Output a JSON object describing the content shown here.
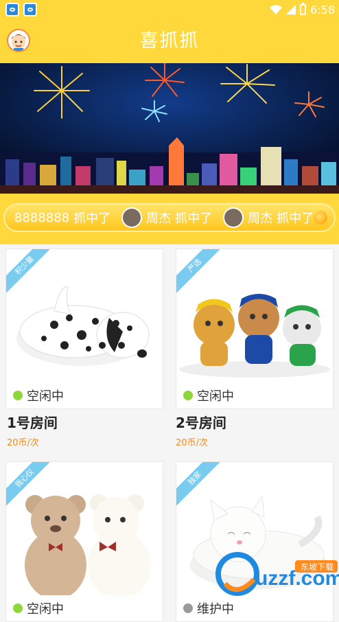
{
  "status_bar": {
    "time": "6:58",
    "notification_icons": [
      "app-notification-icon",
      "app-notification-icon"
    ],
    "system_icons": [
      "wifi-icon",
      "signal-icon",
      "battery-charging-icon"
    ]
  },
  "app_bar": {
    "title": "喜抓抓",
    "avatar_icon": "user-avatar"
  },
  "banner": {
    "image": "fireworks-city-night"
  },
  "ticker": {
    "items": [
      {
        "user": "8888888",
        "action": "抓中了"
      },
      {
        "user": "周杰",
        "action": "抓中了"
      },
      {
        "user": "周杰",
        "action": "抓中了"
      }
    ]
  },
  "rooms": [
    {
      "ribbon": "积少量",
      "status": "空闲中",
      "name": "1号房间",
      "price": "20币/次",
      "toy": "dalmatian-plush",
      "status_color": "#8fd63b"
    },
    {
      "ribbon": "严选",
      "status": "空闲中",
      "name": "2号房间",
      "price": "20币/次",
      "toy": "paw-patrol-plush",
      "status_color": "#8fd63b"
    },
    {
      "ribbon": "我心仪",
      "status": "空闲中",
      "name": "",
      "price": "",
      "toy": "teddy-bears-plush",
      "status_color": "#8fd63b"
    },
    {
      "ribbon": "独家",
      "status": "维护中",
      "name": "",
      "price": "",
      "toy": "white-cat-plush",
      "status_color": "#9a9a9a"
    }
  ],
  "watermark": {
    "brand": "uzzf.com",
    "tag": "东坡下载"
  },
  "colors": {
    "primary": "#ffd93c",
    "ribbon": "#79cbef",
    "idle_dot": "#8fd63b",
    "price": "#f08a22"
  }
}
